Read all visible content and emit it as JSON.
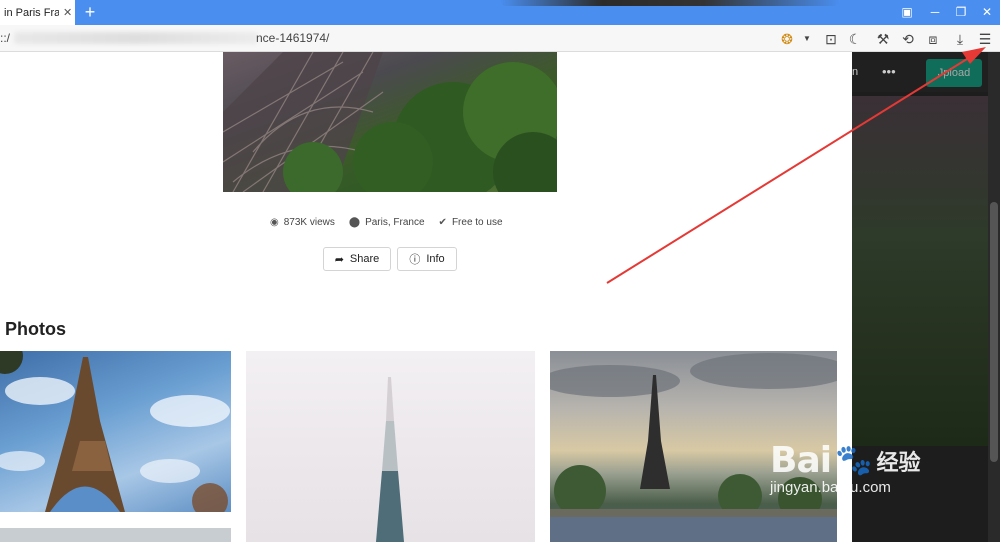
{
  "browser": {
    "tab_title": "in Paris Frar",
    "tab_close": "✕",
    "new_tab": "+",
    "url_prefix": "::/",
    "url_visible": "nce-1461974/",
    "window_buttons": [
      "▣",
      "─",
      "❐",
      "✕"
    ]
  },
  "toolbar_icons": [
    "extension-icon",
    "dropdown-icon",
    "briefcase-icon",
    "night-mode-icon",
    "tools-icon",
    "translate-icon",
    "crop-icon",
    "download-icon",
    "menu-icon"
  ],
  "photo_page": {
    "stats": {
      "views": "873K views",
      "location": "Paris, France",
      "license": "Free to use"
    },
    "share_label": "Share",
    "info_label": "Info",
    "section_title": "Photos"
  },
  "side_panel": {
    "partial_text": "n",
    "dots": "•••",
    "upload_label": "Jpload"
  },
  "watermark": {
    "logo": "Bai",
    "logo_suffix": "百",
    "logo_cn": "经验",
    "url": "jingyan.baidu.com"
  },
  "colors": {
    "tab_bar": "#4a8ef0",
    "accent_green": "#05a081",
    "annotation_arrow": "#e53935"
  }
}
